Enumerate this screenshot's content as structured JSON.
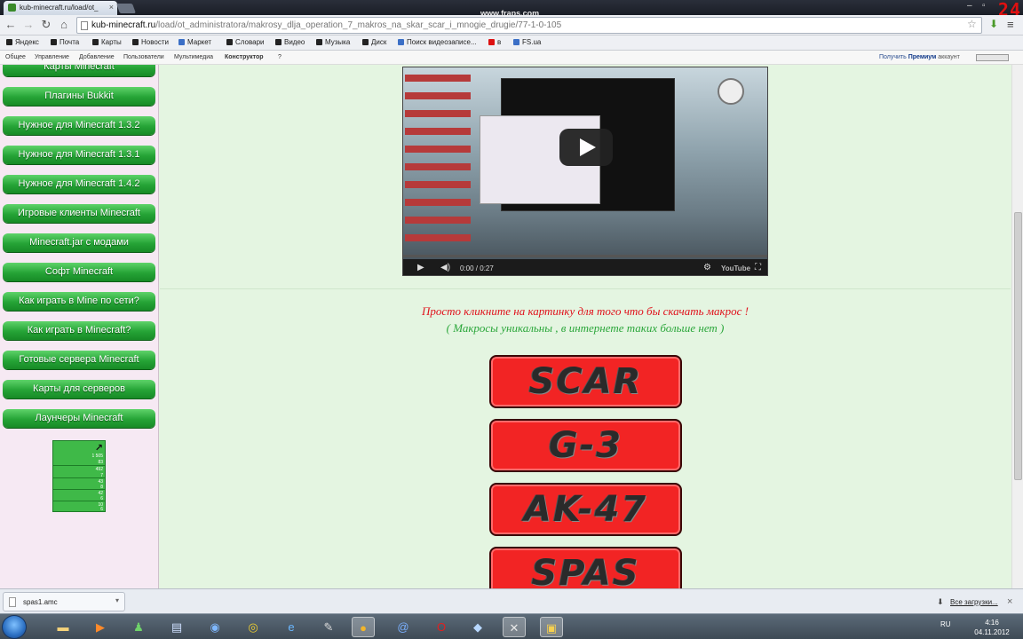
{
  "browser": {
    "tab_title": "kub-minecraft.ru/load/ot_",
    "tab_close": "×",
    "overlay": "www.fraps.com",
    "fps": "24",
    "url_host": "kub-minecraft.ru",
    "url_path": "/load/ot_administratora/makrosy_dlja_operation_7_makros_na_skar_scar_i_mnogie_drugie/77-1-0-105"
  },
  "bookmarks": [
    "Яндекс",
    "Почта",
    "Карты",
    "Новости",
    "Маркет",
    "Словари",
    "Видео",
    "Музыка",
    "Диск",
    "Поиск видеозаписе...",
    "в",
    "FS.ua"
  ],
  "panel": {
    "items": [
      "Общее",
      "Управление",
      "Добавление",
      "Пользователи",
      "Мультимедиа"
    ],
    "bold": "Конструктор",
    "question": "?",
    "right_pre": "Получить",
    "right_bold": "Премиум",
    "right_post": "аккаунт"
  },
  "sidebar": {
    "items": [
      "Карты Minecraft",
      "Плагины Bukkit",
      "Нужное для Minecraft 1.3.2",
      "Нужное для Minecraft 1.3.1",
      "Нужное для Minecraft 1.4.2",
      "Игровые клиенты Minecraft",
      "Minecraft.jar с модами",
      "Софт Minecraft",
      "Как играть в Mine по сети?",
      "Как играть в Minecraft?",
      "Готовые сервера Minecraft",
      "Карты для серверов",
      "Лаунчеры Minecraft"
    ],
    "counter": [
      "1 505",
      "83",
      "492",
      "7",
      "43",
      "8",
      "42",
      "6",
      "10",
      "6"
    ]
  },
  "video": {
    "time": "0:00 / 0:27",
    "brand": "YouTube"
  },
  "content": {
    "line1": "Просто кликните на картинку для того что бы скачать макрос !",
    "line2": "( Макросы уникальны , в интернете таких больше нет )",
    "buttons": [
      "SCAR",
      "G-3",
      "AK-47",
      "SPAS"
    ]
  },
  "downloads": {
    "file": "spas1.amc",
    "all": "Все загрузки..."
  },
  "taskbar": {
    "lang": "RU",
    "time": "4:16",
    "date": "04.11.2012"
  }
}
